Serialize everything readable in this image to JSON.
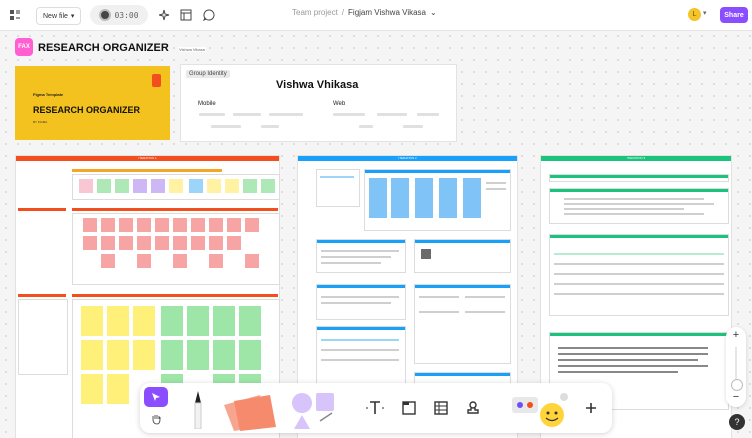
{
  "topbar": {
    "new_file": "New file",
    "timer": "03:00",
    "team": "Team project",
    "separator": "/",
    "file_name": "Figjam Vishwa Vikasa",
    "avatar_initial": "L",
    "share": "Share"
  },
  "page": {
    "logo_text": "FAX",
    "title": "RESEARCH ORGANIZER",
    "tag": "Vishwa Vikasa"
  },
  "cover": {
    "small": "Figma Template",
    "big": "RESEARCH ORGANIZER",
    "by": "BY FIGMA"
  },
  "group_identity": {
    "label": "Group Identity",
    "name": "Vishwa Vhikasa",
    "mobile": "Mobile",
    "web": "Web"
  },
  "frames": {
    "f1": "ITERATION 1",
    "f2": "ITERATION 2",
    "f3": "ITERATION 3"
  },
  "zoom": {
    "plus": "+",
    "minus": "−"
  },
  "help": "?",
  "colors": {
    "accent": "#8a4dff",
    "cover": "#f4c21f",
    "frame1": "#f24e1e",
    "frame2": "#18a0fb",
    "frame3": "#1bc47d"
  }
}
